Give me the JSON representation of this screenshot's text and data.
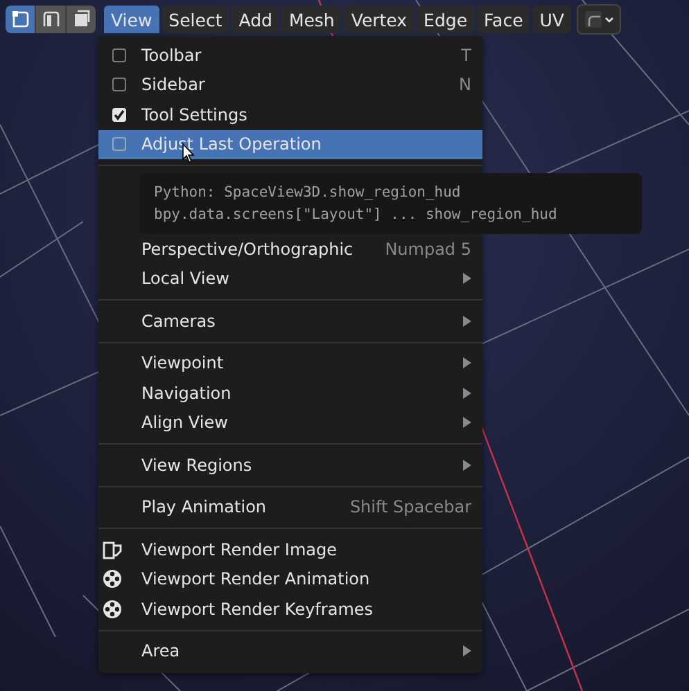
{
  "header": {
    "mode_buttons": [
      {
        "selected": true
      },
      {
        "selected": false
      },
      {
        "selected": false
      }
    ],
    "menus": [
      {
        "label": "View",
        "selected": true
      },
      {
        "label": "Select",
        "selected": false
      },
      {
        "label": "Add",
        "selected": false
      },
      {
        "label": "Mesh",
        "selected": false
      },
      {
        "label": "Vertex",
        "selected": false
      },
      {
        "label": "Edge",
        "selected": false
      },
      {
        "label": "Face",
        "selected": false
      },
      {
        "label": "UV",
        "selected": false
      }
    ]
  },
  "menu": {
    "items": [
      {
        "kind": "check",
        "label": "Toolbar",
        "checked": false,
        "shortcut": "T",
        "selected": false
      },
      {
        "kind": "check",
        "label": "Sidebar",
        "checked": false,
        "shortcut": "N",
        "selected": false
      },
      {
        "kind": "check",
        "label": "Tool Settings",
        "checked": true,
        "selected": false
      },
      {
        "kind": "check",
        "label": "Adjust Last Operation",
        "checked": false,
        "selected": true
      },
      {
        "kind": "separator"
      },
      {
        "kind": "tooltip",
        "lines": [
          "Python: SpaceView3D.show_region_hud",
          "bpy.data.screens[\"Layout\"] ... show_region_hud"
        ]
      },
      {
        "kind": "action",
        "label": "Perspective/Orthographic",
        "shortcut": "Numpad 5",
        "submenu": false,
        "selected": false
      },
      {
        "kind": "action",
        "label": "Local View",
        "submenu": true,
        "selected": false
      },
      {
        "kind": "separator"
      },
      {
        "kind": "action",
        "label": "Cameras",
        "submenu": true,
        "selected": false
      },
      {
        "kind": "separator"
      },
      {
        "kind": "action",
        "label": "Viewpoint",
        "submenu": true,
        "selected": false
      },
      {
        "kind": "action",
        "label": "Navigation",
        "submenu": true,
        "selected": false
      },
      {
        "kind": "action",
        "label": "Align View",
        "submenu": true,
        "selected": false
      },
      {
        "kind": "separator"
      },
      {
        "kind": "action",
        "label": "View Regions",
        "submenu": true,
        "selected": false
      },
      {
        "kind": "separator"
      },
      {
        "kind": "action",
        "label": "Play Animation",
        "shortcut": "Shift Spacebar",
        "submenu": false,
        "selected": false
      },
      {
        "kind": "separator"
      },
      {
        "kind": "image_action",
        "label": "Viewport Render Image",
        "submenu": false,
        "selected": false
      },
      {
        "kind": "reel_action",
        "label": "Viewport Render Animation",
        "submenu": false,
        "selected": false
      },
      {
        "kind": "reel_action",
        "label": "Viewport Render Keyframes",
        "submenu": false,
        "selected": false
      },
      {
        "kind": "separator"
      },
      {
        "kind": "action",
        "label": "Area",
        "submenu": true,
        "selected": false
      }
    ]
  }
}
